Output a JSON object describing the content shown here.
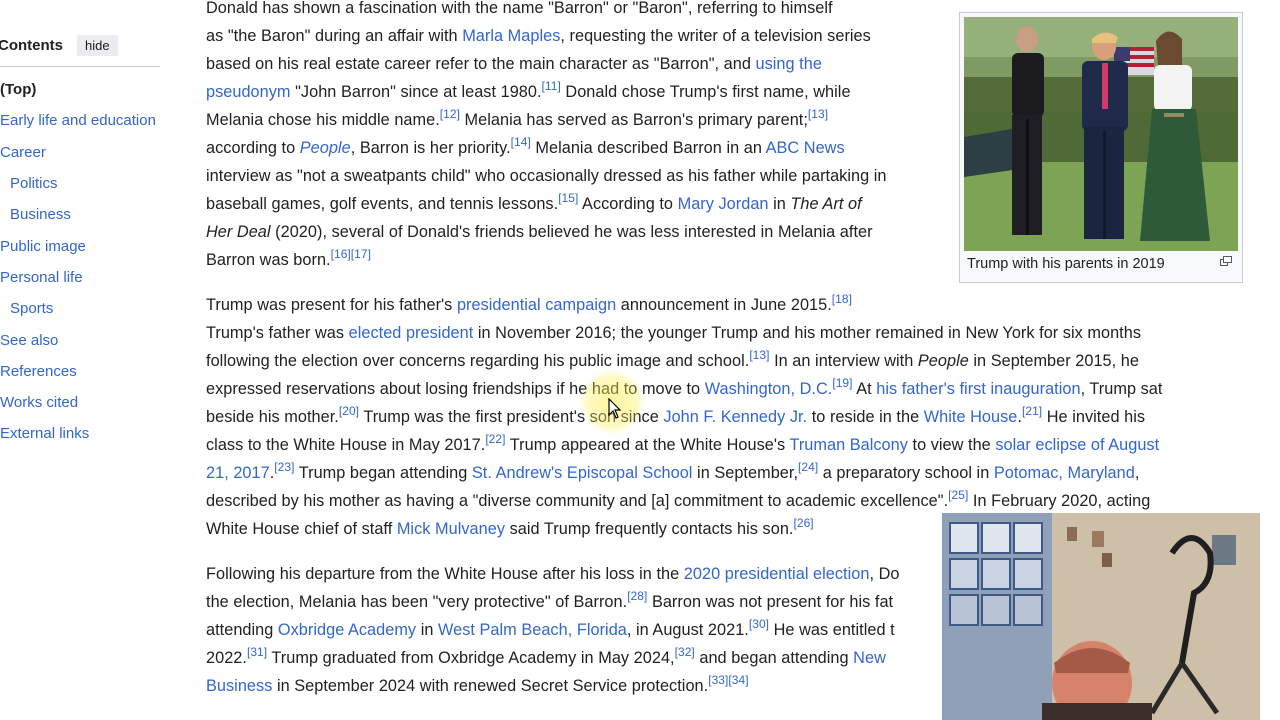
{
  "toc": {
    "title": "Contents",
    "hide_label": "hide",
    "items": [
      "(Top)",
      "Early life and education",
      "Career",
      "Politics",
      "Business",
      "Public image",
      "Personal life",
      "Sports",
      "See also",
      "References",
      "Works cited",
      "External links"
    ]
  },
  "figure": {
    "caption": "Trump with his parents in 2019",
    "enlarge_icon": "magnify-clip-icon"
  },
  "para1": {
    "l1": "Donald has shown a fascination with the name \"Barron\" or \"Baron\", referring to himself",
    "l2a": "as \"the Baron\" during an affair with ",
    "l2_link": "Marla Maples",
    "l2b": ", requesting the writer of a television series",
    "l3a": "based on his real estate career refer to the main character as \"Barron\", and ",
    "l3_link": "using the",
    "l4_link": "pseudonym",
    "l4a": " \"John Barron\" since at least 1980.",
    "l4_ref": "[11]",
    "l4b": " Donald chose Trump's first name, while",
    "l5a": "Melania chose his middle name.",
    "l5_ref1": "[12]",
    "l5b": " Melania has served as Barron's primary parent;",
    "l5_ref2": "[13]",
    "l6a": "according to ",
    "l6_em": "People",
    "l6b": ", Barron is her priority.",
    "l6_ref": "[14]",
    "l6c": " Melania described Barron in an ",
    "l6_link": "ABC News",
    "l7": "interview as \"not a sweatpants child\" who occasionally dressed as his father while partaking in",
    "l8a": "baseball games, golf events, and tennis lessons.",
    "l8_ref": "[15]",
    "l8b": " According to ",
    "l8_link": "Mary Jordan",
    "l8c": " in ",
    "l8_em": "The Art of",
    "l9_em": "Her Deal",
    "l9a": " (2020), several of Donald's friends believed he was less interested in Melania after",
    "l10a": "Barron was born.",
    "l10_ref": "[16][17]"
  },
  "para2": {
    "l1a": "Trump was present for his father's ",
    "l1_link": "presidential campaign",
    "l1b": " announcement in June 2015.",
    "l1_ref": "[18]",
    "l2a": "Trump's father was ",
    "l2_link": "elected president",
    "l2b": " in November 2016; the younger Trump and his mother remained in New York for six months",
    "l3a": "following the election over concerns regarding his public image and school.",
    "l3_ref": "[13]",
    "l3b": " In an interview with ",
    "l3_em": "People",
    "l3c": " in September 2015, he",
    "l4a": "expressed reservations about losing friendships if he had to move to ",
    "l4_link1": "Washington, D.C.",
    "l4_ref": "[19]",
    "l4b": " At ",
    "l4_link2": "his father's first inauguration",
    "l4c": ", Trump sat",
    "l5a": "beside his mother.",
    "l5_ref1": "[20]",
    "l5b": " Trump was the first president's son since ",
    "l5_link1": "John F. Kennedy Jr.",
    "l5c": " to reside in the ",
    "l5_link2": "White House",
    "l5d": ".",
    "l5_ref2": "[21]",
    "l5e": " He invited his",
    "l6a": "class to the White House in May 2017.",
    "l6_ref": "[22]",
    "l6b": " Trump appeared at the White House's ",
    "l6_link1": "Truman Balcony",
    "l6c": " to view the ",
    "l6_link2": "solar eclipse of August",
    "l7_link": "21, 2017",
    "l7a": ".",
    "l7_ref1": "[23]",
    "l7b": " Trump began attending ",
    "l7_link2": "St. Andrew's Episcopal School",
    "l7c": " in September,",
    "l7_ref2": "[24]",
    "l7d": " a preparatory school in ",
    "l7_link3": "Potomac, Maryland",
    "l7e": ",",
    "l8a": "described by his mother as having a \"diverse community and [a] commitment to academic excellence\".",
    "l8_ref": "[25]",
    "l8b": " In February 2020, acting",
    "l9a": "White House chief of staff ",
    "l9_link": "Mick Mulvaney",
    "l9b": " said Trump frequently contacts his son.",
    "l9_ref": "[26]"
  },
  "para3": {
    "l1a": "Following his departure from the White House after his loss in the ",
    "l1_link": "2020 presidential election",
    "l1b": ", Do",
    "l2a": "the election, Melania has been \"very protective\" of Barron.",
    "l2_ref": "[28]",
    "l2b": " Barron was not present for his fat",
    "l3a": "attending ",
    "l3_link1": "Oxbridge Academy",
    "l3b": " in ",
    "l3_link2": "West Palm Beach, Florida",
    "l3c": ", in August 2021.",
    "l3_ref": "[30]",
    "l3d": " He was entitled t",
    "l4a": "2022.",
    "l4_ref1": "[31]",
    "l4b": " Trump graduated from Oxbridge Academy in May 2024,",
    "l4_ref2": "[32]",
    "l4c": " and began attending ",
    "l4_link": "New",
    "l5_link": "Business",
    "l5a": " in September 2024 with renewed Secret Service protection.",
    "l5_ref": "[33][34]"
  }
}
